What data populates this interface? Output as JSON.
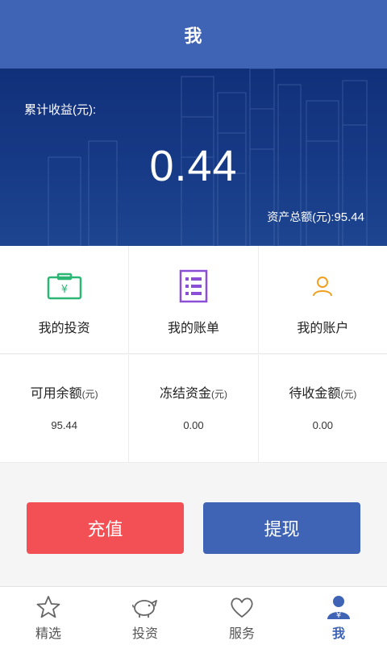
{
  "header": {
    "title": "我"
  },
  "banner": {
    "cumulative_label": "累计收益(元):",
    "cumulative_value": "0.44",
    "total_label": "资产总额(元):",
    "total_value": "95.44"
  },
  "menu": [
    {
      "label": "我的投资",
      "icon": "money-bag-icon",
      "color": "#2bb673"
    },
    {
      "label": "我的账单",
      "icon": "bill-list-icon",
      "color": "#8a4fd6"
    },
    {
      "label": "我的账户",
      "icon": "user-icon",
      "color": "#f0a020"
    }
  ],
  "stats": [
    {
      "label": "可用余额",
      "unit": "(元)",
      "value": "95.44"
    },
    {
      "label": "冻结资金",
      "unit": "(元)",
      "value": "0.00"
    },
    {
      "label": "待收金额",
      "unit": "(元)",
      "value": "0.00"
    }
  ],
  "actions": {
    "recharge": "充值",
    "withdraw": "提现"
  },
  "tabs": [
    {
      "label": "精选",
      "icon": "star-icon",
      "active": false
    },
    {
      "label": "投资",
      "icon": "piggy-bank-icon",
      "active": false
    },
    {
      "label": "服务",
      "icon": "heart-icon",
      "active": false
    },
    {
      "label": "我",
      "icon": "person-yen-icon",
      "active": true
    }
  ],
  "colors": {
    "primary": "#3f63b5",
    "banner": "#173a86",
    "danger": "#f25054"
  }
}
